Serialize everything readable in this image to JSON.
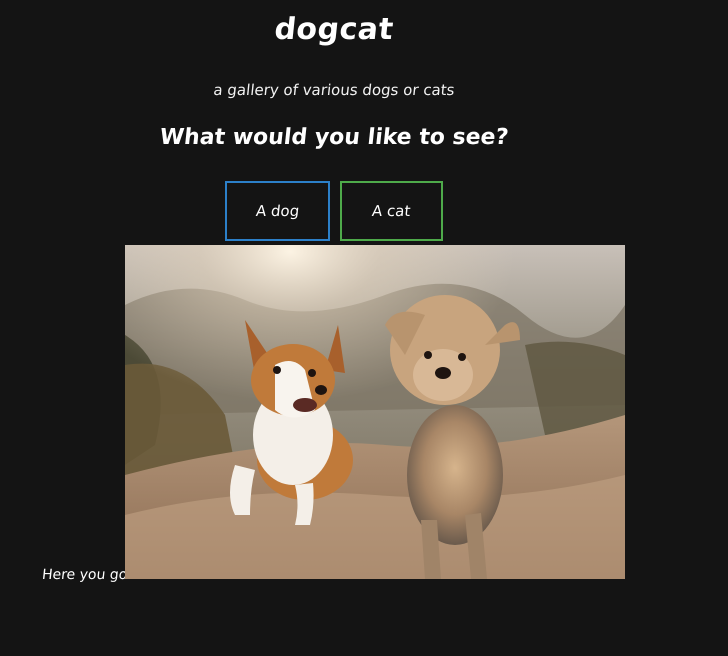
{
  "header": {
    "title": "dogcat",
    "subtitle": "a gallery of various dogs or cats",
    "question": "What would you like to see?"
  },
  "buttons": {
    "dog_label": "A dog",
    "cat_label": "A cat"
  },
  "image": {
    "caption": "Here you go!"
  },
  "colors": {
    "background": "#141414",
    "dog_button_border": "#2c80c9",
    "cat_button_border": "#4eaa4a"
  }
}
